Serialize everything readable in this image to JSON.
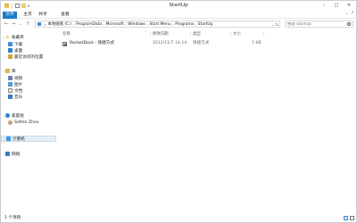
{
  "window": {
    "title": "StartUp",
    "controls": {
      "minimize": "–",
      "maximize": "□",
      "close": "✕"
    }
  },
  "ribbon": {
    "tabs": [
      {
        "label": "文件",
        "active": true
      },
      {
        "label": "主页"
      },
      {
        "label": "共享"
      },
      {
        "label": "查看"
      }
    ],
    "expand_glyph": "⌄",
    "help_glyph": "?"
  },
  "nav": {
    "back": "←",
    "forward": "→",
    "recent": "⌄",
    "up": "↑"
  },
  "address": {
    "crumbs": [
      "本地磁盘 (C:)",
      "ProgramData",
      "Microsoft",
      "Windows",
      "Start Menu",
      "Programs",
      "StartUp"
    ],
    "separator": "›",
    "lead_separator": "»",
    "dropdown_glyph": "⌄",
    "refresh_glyph": "↻"
  },
  "search": {
    "placeholder": "搜索 StartUp"
  },
  "navpane": {
    "items": [
      {
        "label": "收藏夹",
        "icon": "favorites-star-icon",
        "level": 0,
        "arrow": "⌄"
      },
      {
        "label": "下载",
        "icon": "downloads-icon",
        "level": 1
      },
      {
        "label": "桌面",
        "icon": "desktop-icon",
        "level": 1
      },
      {
        "label": "最近访问的位置",
        "icon": "recent-places-icon",
        "level": 1
      },
      {
        "label": "库",
        "icon": "libraries-icon",
        "level": 0,
        "arrow": "⌄"
      },
      {
        "label": "视频",
        "icon": "videos-icon",
        "level": 1
      },
      {
        "label": "图片",
        "icon": "pictures-icon",
        "level": 1
      },
      {
        "label": "文档",
        "icon": "documents-icon",
        "level": 1
      },
      {
        "label": "音乐",
        "icon": "music-icon",
        "level": 1
      },
      {
        "label": "家庭组",
        "icon": "homegroup-icon",
        "level": 0,
        "arrow": "⌄"
      },
      {
        "label": "Sdifen Zhou",
        "icon": "user-icon",
        "level": 1
      },
      {
        "label": "计算机",
        "icon": "computer-icon",
        "level": 0,
        "arrow": "›",
        "selected": true
      },
      {
        "label": "网络",
        "icon": "network-icon",
        "level": 0,
        "arrow": "›"
      }
    ]
  },
  "columns": {
    "name": "名称",
    "date": "修改日期",
    "type": "类型",
    "size": "大小",
    "sort_glyph": "^"
  },
  "files": [
    {
      "name": "RocketDock - 快捷方式",
      "date": "2012/11/7 14:14",
      "type": "快捷方式",
      "size": "1 KB"
    }
  ],
  "status": {
    "count": "1 个项目"
  },
  "colors": {
    "file_tab": "#1979ca",
    "selection": "#e5eff8"
  }
}
